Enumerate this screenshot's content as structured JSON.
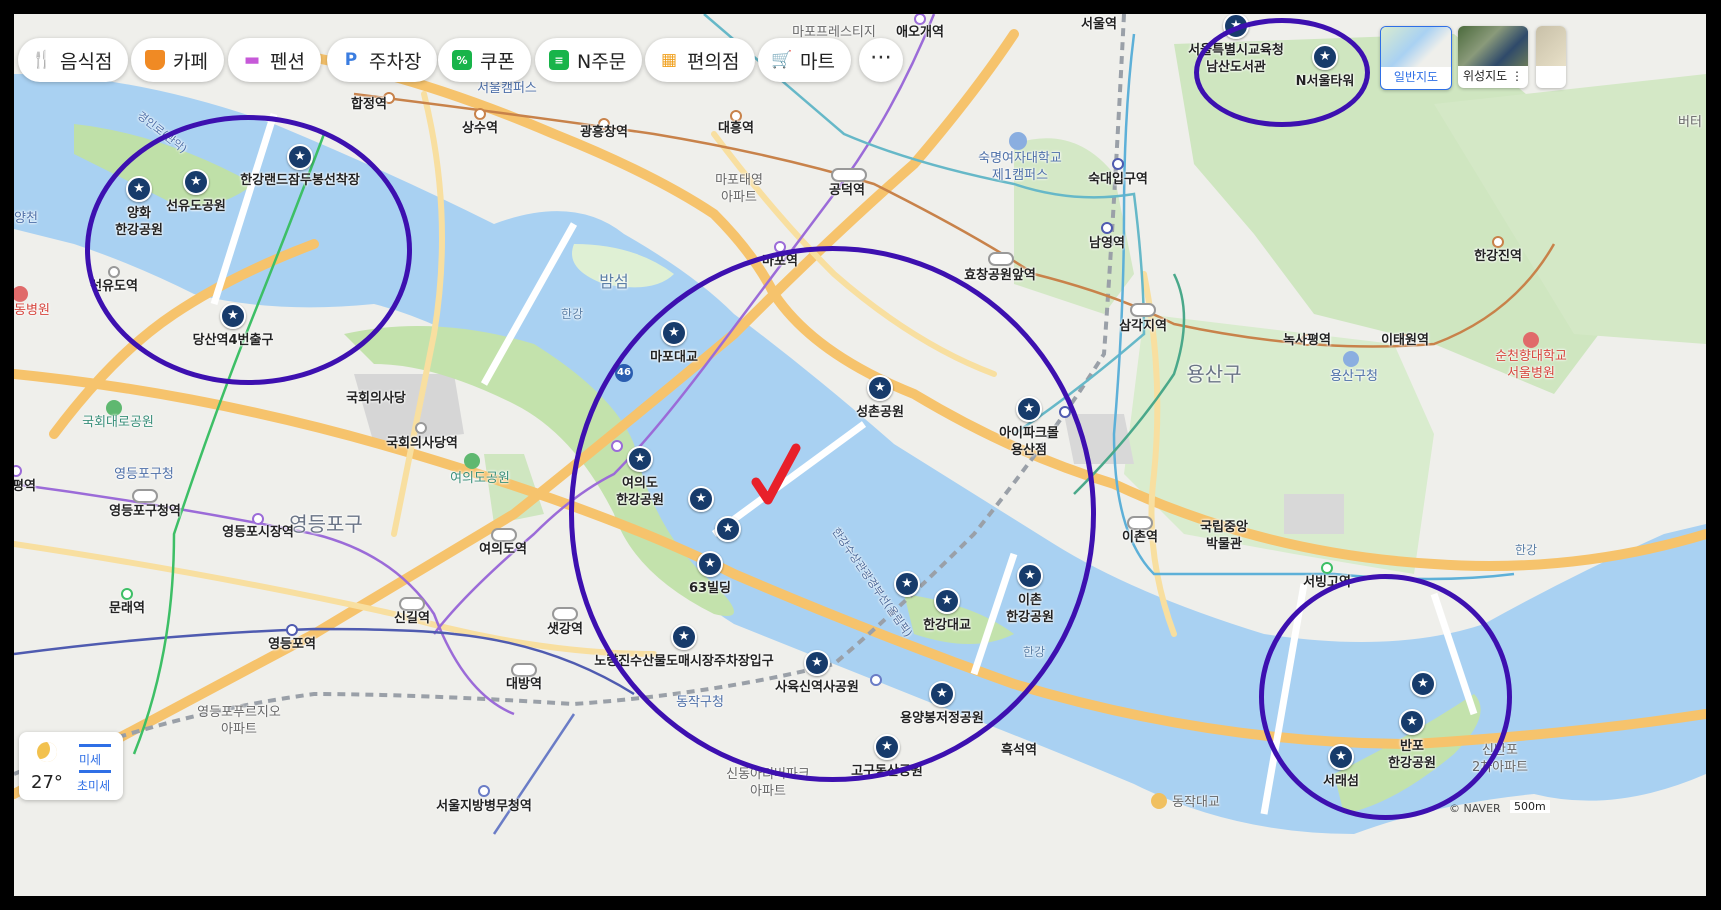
{
  "categories": [
    {
      "label": "음식점",
      "icon": "fork-knife-icon",
      "color": "#f08a24"
    },
    {
      "label": "카페",
      "icon": "coffee-cup-icon",
      "color": "#f08a24"
    },
    {
      "label": "펜션",
      "icon": "bed-icon",
      "color": "#c659d8"
    },
    {
      "label": "주차장",
      "icon": "parking-icon",
      "color": "#3b7de0"
    },
    {
      "label": "쿠폰",
      "icon": "coupon-icon",
      "color": "#18b44a"
    },
    {
      "label": "N주문",
      "icon": "order-icon",
      "color": "#18b44a"
    },
    {
      "label": "편의점",
      "icon": "store-icon",
      "color": "#f0a01e"
    },
    {
      "label": "마트",
      "icon": "cart-icon",
      "color": "#f0a01e"
    }
  ],
  "more_label": "⋯",
  "map_types": [
    {
      "label": "일반지도",
      "active": true
    },
    {
      "label": "위성지도 ⋮",
      "active": false
    }
  ],
  "weather": {
    "temp": "27°",
    "fine_dust": "미세",
    "ultra_fine_dust": "초미세"
  },
  "scale": {
    "label": "500m"
  },
  "copyright": "© NAVER",
  "annotation_color": "#3d10b0",
  "check_color": "#e8202a",
  "poi": {
    "hangang_land": "한강랜드잠두봉선착장",
    "yanghwa_park": "양화\n한강공원",
    "seonyudo_park": "선유도공원",
    "dangsan_exit": "당산역4번출구",
    "namsan_library": "서울특별시교육청\n남산도서관",
    "n_seoul_tower": "N서울타워",
    "mapo_bridge": "마포대교",
    "seongchon_park": "성촌공원",
    "ipark_mall": "아이파크몰\n용산점",
    "yeouido_park": "여의도\n한강공원",
    "building_63": "63빌딩",
    "noryangjin_parking": "노량진수산물도매시장주차장입구",
    "sayuksin_park": "사육신역사공원",
    "hangang_bridge": "한강대교",
    "ichon_park": "이촌\n한강공원",
    "yongbongjeong_park": "용양봉저정공원",
    "gogudong_park": "고구동산공원",
    "seoraeseom": "서래섬",
    "banpo_park": "반포\n한강공원"
  },
  "stations": {
    "hapjeong": "합정역",
    "sangsu": "상수역",
    "gwangheungchang": "광흥창역",
    "daeheung": "대흥역",
    "aeogae": "애오개역",
    "seoul": "서울역",
    "gongdeok": "공덕역",
    "mapo": "마포역",
    "hyochang": "효창공원앞역",
    "sookdae": "숙대입구역",
    "namyeong": "남영역",
    "samgakji": "삼각지역",
    "noksapyeong": "녹사평역",
    "itaewon": "이태원역",
    "hangangjin": "한강진역",
    "seonyudo": "선유도역",
    "gukhoe": "국회의사당역",
    "yeouido": "여의도역",
    "yeongdeungpo_gu": "영등포구청역",
    "yeongdeungpo_market": "영등포시장역",
    "singil": "신길역",
    "saetgang": "샛강역",
    "daebang": "대방역",
    "yeongdeungpo": "영등포역",
    "mullae": "문래역",
    "ichon": "이촌역",
    "seobinggo": "서빙고역",
    "heukseok": "흑석역",
    "pyeong": "평역",
    "seoul_nambu_court": "서울지방병무청역"
  },
  "places": {
    "hongik": "서울캠퍼스",
    "sookmyung": "숙명여자대학교\n제1캠퍼스",
    "mapo_apt": "마포태영\n아파트",
    "gukhoe": "국회의사당",
    "gukhoe_park": "국회대로공원",
    "ydp_office": "영등포구청",
    "yeouido_park": "여의도공원",
    "museum": "국립중앙\n박물관",
    "yongsan_office": "용산구청",
    "ydp_market_apt": "영등포푸르지오\n아파트",
    "dongjak_office": "동작구청",
    "sindong_apt": "신동아리버파크\n아파트",
    "sunchunhyang": "순천향대학교\n서울병원",
    "dong_hospital": "동병원",
    "sinbanpo_apt": "신반포\n2차아파트",
    "dongjak_bridge": "동작대교",
    "berth": "버터",
    "mapo_culture": "마포프레스티지"
  },
  "areas": {
    "yongsan": "용산구",
    "yeongdeungpo": "영등포구",
    "bamseom": "밤섬"
  },
  "water": {
    "hangang1": "한강",
    "hangang2": "한강",
    "hangang3": "한강",
    "route_label": "한강수상관광경부선(올림픽)",
    "hwy46": "46"
  },
  "misc": {
    "yangcheon": "양천",
    "route_left": "경인로(관악)"
  }
}
